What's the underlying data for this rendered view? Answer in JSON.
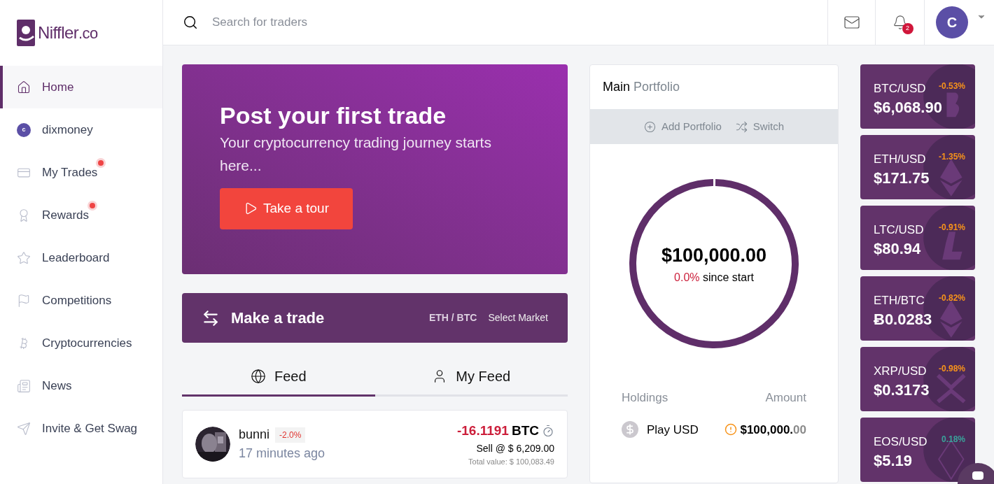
{
  "brand": {
    "name": "Niffler",
    "suffix": ".co"
  },
  "search": {
    "placeholder": "Search for traders"
  },
  "header": {
    "notifications": "2",
    "avatar_letter": "C"
  },
  "sidebar": {
    "items": [
      {
        "label": "Home",
        "kind": "home",
        "selected": true,
        "dot": false
      },
      {
        "label": "dixmoney",
        "kind": "user",
        "avatar_letter": "c",
        "selected": false,
        "dot": false
      },
      {
        "label": "My Trades",
        "kind": "trades",
        "selected": false,
        "dot": true
      },
      {
        "label": "Rewards",
        "kind": "rewards",
        "selected": false,
        "dot": true
      },
      {
        "label": "Leaderboard",
        "kind": "star",
        "selected": false,
        "dot": false
      },
      {
        "label": "Competitions",
        "kind": "flag",
        "selected": false,
        "dot": false
      },
      {
        "label": "Cryptocurrencies",
        "kind": "coin",
        "selected": false,
        "dot": false
      },
      {
        "label": "News",
        "kind": "news",
        "selected": false,
        "dot": false
      },
      {
        "label": "Invite & Get Swag",
        "kind": "send",
        "selected": false,
        "dot": false
      }
    ]
  },
  "hero": {
    "title": "Post your first trade",
    "subtitle": "Your cryptocurrency trading journey starts here...",
    "button": "Take a tour"
  },
  "trade_bar": {
    "title": "Make a trade",
    "market": "ETH / BTC",
    "action": "Select Market"
  },
  "feed_tabs": [
    {
      "label": "Feed",
      "kind": "globe",
      "selected": true
    },
    {
      "label": "My Feed",
      "kind": "user",
      "selected": false
    }
  ],
  "feed": [
    {
      "user": "bunni",
      "change": "-2.0%",
      "time": "17 minutes ago",
      "amount": "-16.1191",
      "unit": "BTC",
      "order": "Sell @ $ 6,209.00",
      "total": "Total value: $ 100,083.49"
    }
  ],
  "portfolio": {
    "title": "Main",
    "title_muted": "Portfolio",
    "actions": [
      {
        "label": "Add Portfolio",
        "kind": "add"
      },
      {
        "label": "Switch",
        "kind": "shuffle"
      }
    ],
    "value": "$100,000.00",
    "change": "0.0%",
    "change_label": "since start",
    "columns": [
      "Holdings",
      "Amount"
    ],
    "holdings": [
      {
        "name": "Play USD",
        "amount": "$100,000.",
        "amount_cents": "00",
        "warning": true
      }
    ]
  },
  "tickers": [
    {
      "pair": "BTC/USD",
      "change": "-0.53%",
      "color": "#f7931a",
      "price": "$6,068.90",
      "kind": "btc"
    },
    {
      "pair": "ETH/USD",
      "change": "-1.35%",
      "color": "#f7931a",
      "price": "$171.75",
      "kind": "eth"
    },
    {
      "pair": "LTC/USD",
      "change": "-0.91%",
      "color": "#f7931a",
      "price": "$80.94",
      "kind": "ltc"
    },
    {
      "pair": "ETH/BTC",
      "change": "-0.82%",
      "color": "#f7931a",
      "price": "Ƀ0.0283",
      "kind": "eth"
    },
    {
      "pair": "XRP/USD",
      "change": "-0.98%",
      "color": "#f7931a",
      "price": "$0.3173",
      "kind": "xrp"
    },
    {
      "pair": "EOS/USD",
      "change": "0.18%",
      "color": "#3aa39b",
      "price": "$5.19",
      "kind": "eos"
    }
  ]
}
